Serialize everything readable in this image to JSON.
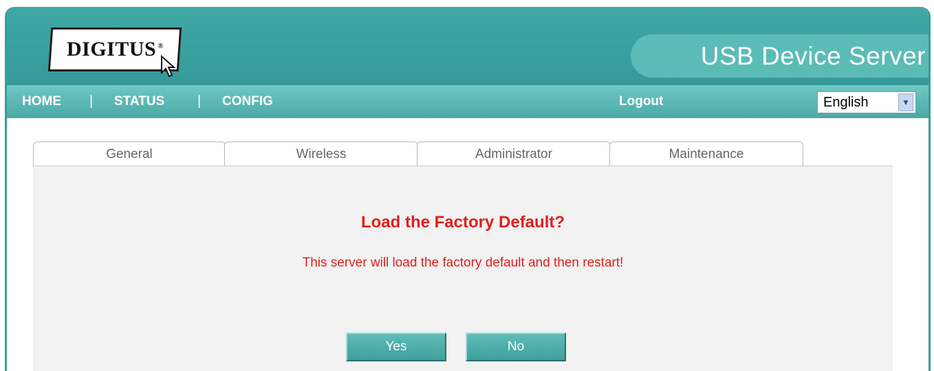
{
  "header": {
    "logo_text": "DIGITUS",
    "logo_mark": "®",
    "product_title": "USB Device Server"
  },
  "nav": {
    "items": [
      "HOME",
      "STATUS",
      "CONFIG"
    ],
    "separator": "|",
    "logout": "Logout",
    "language": "English"
  },
  "tabs": [
    "General",
    "Wireless",
    "Administrator",
    "Maintenance"
  ],
  "dialog": {
    "title": "Load the Factory Default?",
    "message": "This server will load the factory default and then restart!",
    "yes": "Yes",
    "no": "No"
  },
  "colors": {
    "banner": "#3fa8a4",
    "accent_text": "#e0201c",
    "button": "#4fb0ac"
  }
}
